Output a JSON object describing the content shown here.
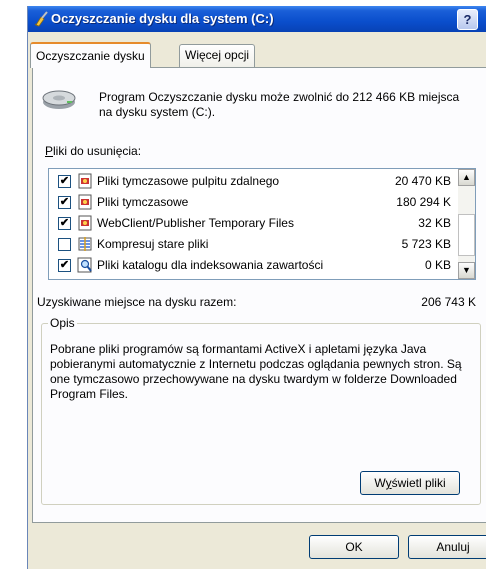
{
  "window": {
    "title": "Oczyszczanie dysku dla system (C:)",
    "help_label": "?",
    "app_icon": "broom-icon"
  },
  "tabs": [
    {
      "label": "Oczyszczanie dysku",
      "active": true
    },
    {
      "label": "Więcej opcji",
      "active": false
    }
  ],
  "summary": {
    "text": "Program Oczyszczanie dysku może zwolnić do 212 466 KB miejsca na dysku system (C:).",
    "icon": "hard-disk-icon"
  },
  "files": {
    "label_accel": "P",
    "label_rest": "liki do usunięcia:",
    "items": [
      {
        "checked": true,
        "name": "Pliki tymczasowe pulpitu zdalnego",
        "size": "20 470 KB",
        "icon": "file-icon"
      },
      {
        "checked": true,
        "name": "Pliki tymczasowe",
        "size": "180 294 K",
        "icon": "file-icon"
      },
      {
        "checked": true,
        "name": "WebClient/Publisher Temporary Files",
        "size": "32 KB",
        "icon": "file-icon"
      },
      {
        "checked": false,
        "name": "Kompresuj stare pliki",
        "size": "5 723 KB",
        "icon": "compress-icon"
      },
      {
        "checked": true,
        "name": "Pliki katalogu dla indeksowania zawartości",
        "size": "0 KB",
        "icon": "catalog-search-icon"
      }
    ]
  },
  "total": {
    "label": "Uzyskiwane miejsce na dysku razem:",
    "value": "206 743 K"
  },
  "description": {
    "legend": "Opis",
    "text": "Pobrane pliki programów są formantami ActiveX i apletami języka Java pobieranymi automatycznie z Internetu podczas oglądania pewnych stron. Są one tymczasowo przechowywane na dysku twardym w folderze Downloaded Program Files.",
    "view_button_pre": "W",
    "view_button_accel": "y",
    "view_button_post": "świetl pliki"
  },
  "buttons": {
    "ok": "OK",
    "cancel": "Anuluj"
  },
  "colors": {
    "titlebar": "#0a4ecc",
    "dialog_bg": "#ece9d8",
    "tab_accent": "#e68b2c"
  }
}
